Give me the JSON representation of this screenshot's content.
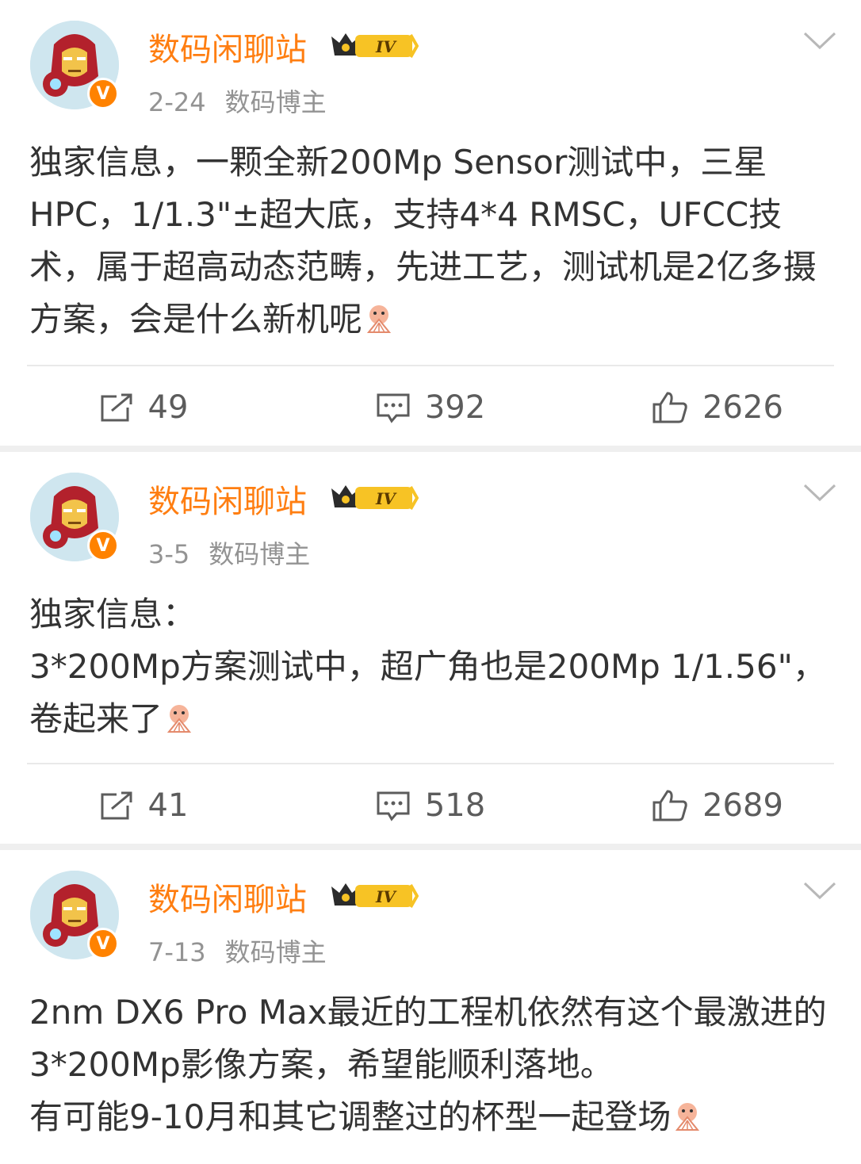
{
  "posts": [
    {
      "author": "数码闲聊站",
      "rank_badge": "IV",
      "verified_badge": "V",
      "date": "2-24",
      "source": "数码博主",
      "content": "独家信息，一颗全新200Mp Sensor测试中，三星HPC，1/1.3\"±超大底，支持4*4 RMSC，UFCC技术，属于超高动态范畴，先进工艺，测试机是2亿多摄方案，会是什么新机呢",
      "reposts": "49",
      "comments": "392",
      "likes": "2626"
    },
    {
      "author": "数码闲聊站",
      "rank_badge": "IV",
      "verified_badge": "V",
      "date": "3-5",
      "source": "数码博主",
      "content": "独家信息：\n3*200Mp方案测试中，超广角也是200Mp 1/1.56\"，卷起来了",
      "reposts": "41",
      "comments": "518",
      "likes": "2689"
    },
    {
      "author": "数码闲聊站",
      "rank_badge": "IV",
      "verified_badge": "V",
      "date": "7-13",
      "source": "数码博主",
      "content": "2nm DX6 Pro Max最近的工程机依然有这个最激进的3*200Mp影像方案，希望能顺利落地。\n有可能9-10月和其它调整过的杯型一起登场"
    }
  ],
  "colors": {
    "accent_orange": "#ff7e11",
    "meta_gray": "#939393",
    "text": "#333333",
    "separator": "#efefef"
  },
  "icons": [
    "ironman-avatar",
    "verified-v-badge",
    "crown-rank-icon",
    "chevron-down-icon",
    "repost-icon",
    "comment-icon",
    "like-icon",
    "fan-emoji-icon"
  ]
}
